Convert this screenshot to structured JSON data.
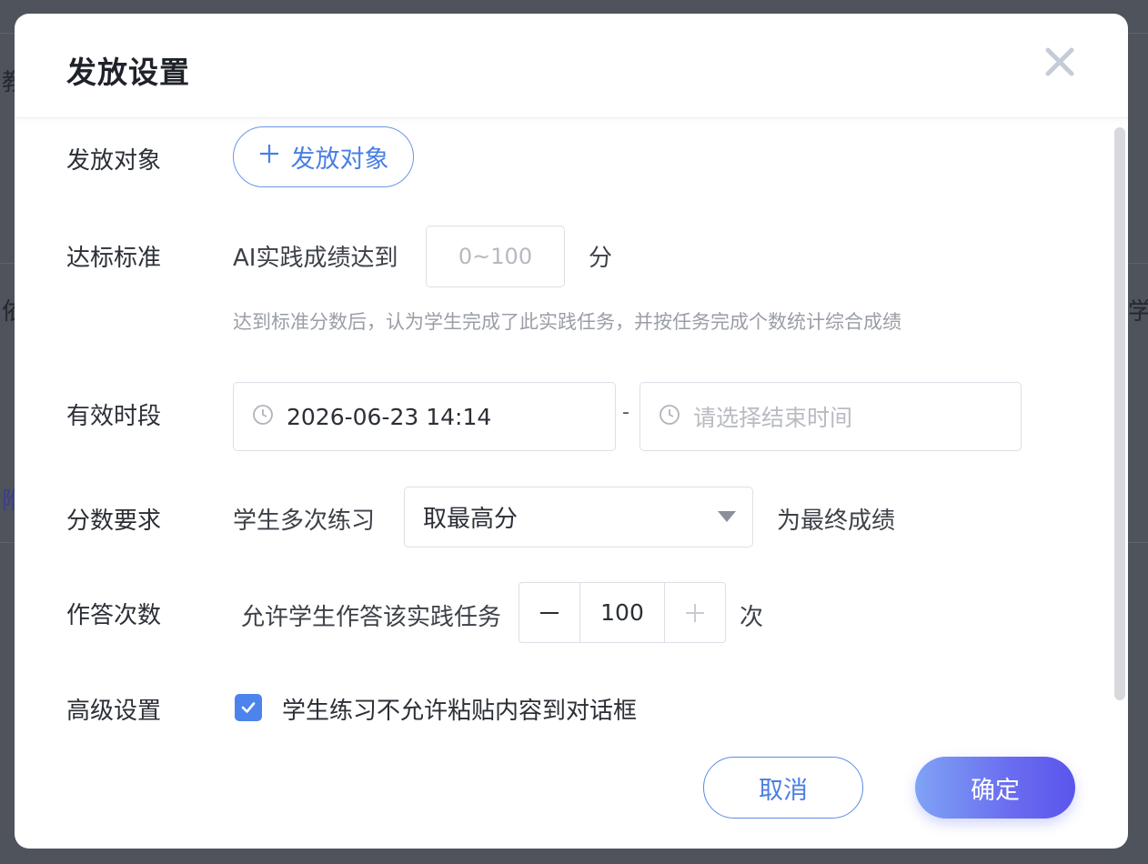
{
  "background": {
    "frag_1": "教",
    "frag_2": "依",
    "frag_3": "附",
    "frag_4": "学"
  },
  "dialog": {
    "title": "发放设置",
    "close_icon": "close-icon"
  },
  "target": {
    "label": "发放对象",
    "button_label": "发放对象",
    "button_icon": "plus-icon"
  },
  "standard": {
    "label": "达标标准",
    "prefix": "AI实践成绩达到",
    "input_value": "",
    "input_placeholder": "0~100",
    "unit": "分",
    "hint": "达到标准分数后，认为学生完成了此实践任务，并按任务完成个数统计综合成绩"
  },
  "period": {
    "label": "有效时段",
    "start_value": "2026-06-23 14:14",
    "separator": "-",
    "end_placeholder": "请选择结束时间",
    "icon": "clock-icon"
  },
  "score": {
    "label": "分数要求",
    "prefix": "学生多次练习",
    "selected": "取最高分",
    "suffix": "为最终成绩"
  },
  "attempts": {
    "label": "作答次数",
    "prefix": "允许学生作答该实践任务",
    "value": "100",
    "suffix": "次"
  },
  "advanced": {
    "label": "高级设置",
    "checkbox_checked": true,
    "checkbox_label": "学生练习不允许粘贴内容到对话框"
  },
  "footer": {
    "cancel_label": "取消",
    "confirm_label": "确定"
  },
  "colors": {
    "accent": "#4a7fe3",
    "checkbox": "#4d84ec",
    "confirm_gradient_start": "#7fa3f5",
    "confirm_gradient_end": "#5a55ec",
    "overlay": "#4f535c"
  }
}
